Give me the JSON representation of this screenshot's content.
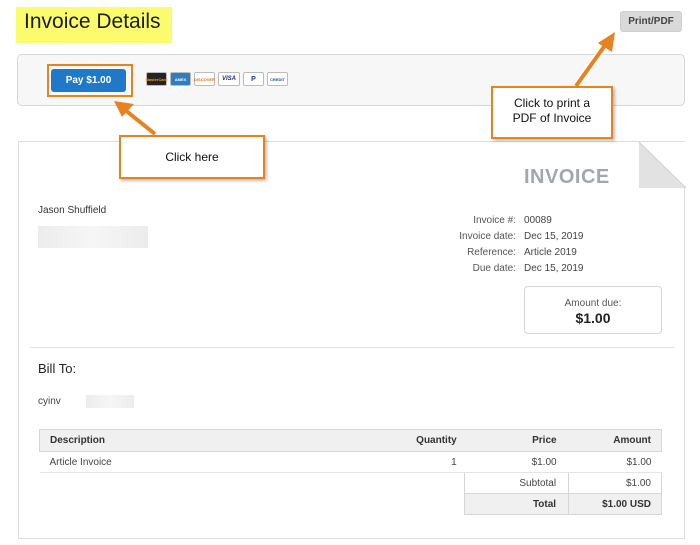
{
  "page": {
    "title": "Invoice Details"
  },
  "toolbar": {
    "print_label": "Print/PDF"
  },
  "payment": {
    "pay_label": "Pay $1.00",
    "cards": [
      {
        "name": "mastercard-icon",
        "text": "MasterCard"
      },
      {
        "name": "amex-icon",
        "text": "AMEX"
      },
      {
        "name": "discover-icon",
        "text": "DISCOVER"
      },
      {
        "name": "visa-icon",
        "text": "VISA"
      },
      {
        "name": "paypal-icon",
        "text": "P"
      },
      {
        "name": "paypal-credit-icon",
        "text": "CREDIT"
      }
    ]
  },
  "callouts": {
    "click_here": "Click here",
    "print_line1": "Click to print a",
    "print_line2": "PDF of Invoice"
  },
  "invoice": {
    "heading": "INVOICE",
    "customer_name": "Jason Shuffield",
    "meta": [
      {
        "label": "Invoice #:",
        "value": "00089"
      },
      {
        "label": "Invoice date:",
        "value": "Dec 15, 2019"
      },
      {
        "label": "Reference:",
        "value": "Article 2019"
      },
      {
        "label": "Due date:",
        "value": "Dec 15, 2019"
      }
    ],
    "amount_due_label": "Amount due:",
    "amount_due_value": "$1.00",
    "bill_to_label": "Bill To:",
    "bill_to_email": "cyinv",
    "table": {
      "headers": [
        "Description",
        "Quantity",
        "Price",
        "Amount"
      ],
      "rows": [
        {
          "description": "Article Invoice",
          "quantity": "1",
          "price": "$1.00",
          "amount": "$1.00"
        }
      ],
      "subtotal_label": "Subtotal",
      "subtotal_value": "$1.00",
      "total_label": "Total",
      "total_value": "$1.00 USD"
    }
  },
  "colors": {
    "accent": "#1f78c8",
    "callout_border": "#e8821f",
    "title_highlight": "#fbfb6e"
  }
}
